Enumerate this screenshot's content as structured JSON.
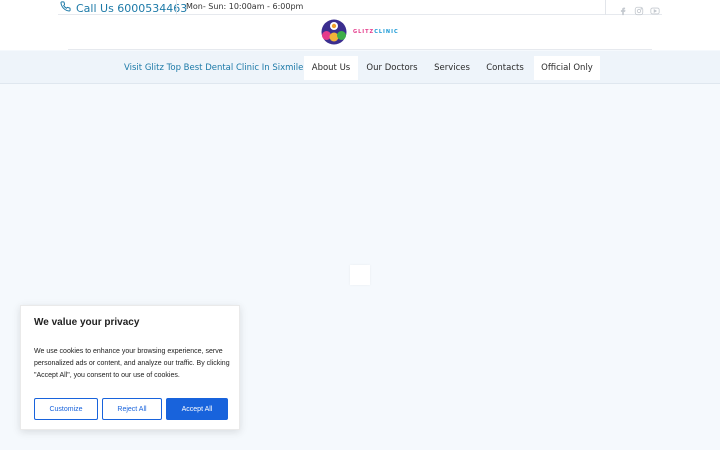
{
  "colors": {
    "accent": "#1d7aa8",
    "cookie_button": "#1863dc",
    "page_background": "#f5f9fd",
    "nav_background": "#eef4fa"
  },
  "topbar": {
    "call_label": "Call Us 6000534463",
    "call_icon": "phone-icon",
    "hours": "Mon- Sun: 10:00am - 6:00pm",
    "social": [
      "facebook-icon",
      "instagram-icon",
      "youtube-icon"
    ]
  },
  "logo": {
    "text_part1": "GLITZ",
    "text_part2": "CLINIC"
  },
  "nav": {
    "items": [
      "Visit Glitz Top Best Dental Clinic In Sixmile",
      "About Us",
      "Our Doctors",
      "Services",
      "Contacts",
      "Official Only"
    ]
  },
  "cookie": {
    "title": "We value your privacy",
    "text": "We use cookies to enhance your browsing experience, serve personalized ads or content, and analyze our traffic. By clicking \"Accept All\", you consent to our use of cookies.",
    "customize_label": "Customize",
    "reject_label": "Reject All",
    "accept_label": "Accept All"
  }
}
